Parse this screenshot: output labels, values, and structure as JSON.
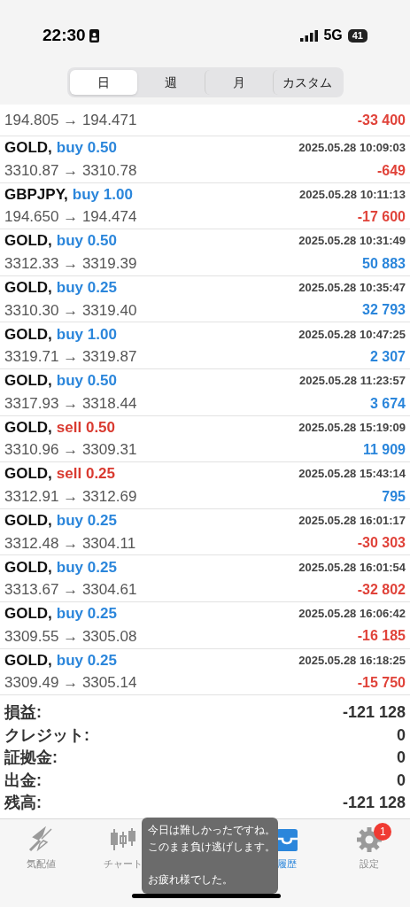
{
  "status_bar": {
    "time": "22:30",
    "network": "5G",
    "battery": "41"
  },
  "tabs": [
    {
      "label": "日",
      "selected": true
    },
    {
      "label": "週",
      "selected": false
    },
    {
      "label": "月",
      "selected": false
    },
    {
      "label": "カスタム",
      "selected": false
    }
  ],
  "partial_row": {
    "prices": "194.805 → 194.471",
    "profit": "-33 400",
    "loss": true
  },
  "trades": [
    {
      "symbol": "GOLD,",
      "kind": "buy",
      "action": "buy 0.50",
      "time": "2025.05.28 10:09:03",
      "prices": "3310.87 → 3310.78",
      "profit": "-649",
      "loss": true
    },
    {
      "symbol": "GBPJPY,",
      "kind": "buy",
      "action": "buy 1.00",
      "time": "2025.05.28 10:11:13",
      "prices": "194.650 → 194.474",
      "profit": "-17 600",
      "loss": true
    },
    {
      "symbol": "GOLD,",
      "kind": "buy",
      "action": "buy 0.50",
      "time": "2025.05.28 10:31:49",
      "prices": "3312.33 → 3319.39",
      "profit": "50 883",
      "loss": false
    },
    {
      "symbol": "GOLD,",
      "kind": "buy",
      "action": "buy 0.25",
      "time": "2025.05.28 10:35:47",
      "prices": "3310.30 → 3319.40",
      "profit": "32 793",
      "loss": false
    },
    {
      "symbol": "GOLD,",
      "kind": "buy",
      "action": "buy 1.00",
      "time": "2025.05.28 10:47:25",
      "prices": "3319.71 → 3319.87",
      "profit": "2 307",
      "loss": false
    },
    {
      "symbol": "GOLD,",
      "kind": "buy",
      "action": "buy 0.50",
      "time": "2025.05.28 11:23:57",
      "prices": "3317.93 → 3318.44",
      "profit": "3 674",
      "loss": false
    },
    {
      "symbol": "GOLD,",
      "kind": "sell",
      "action": "sell 0.50",
      "time": "2025.05.28 15:19:09",
      "prices": "3310.96 → 3309.31",
      "profit": "11 909",
      "loss": false
    },
    {
      "symbol": "GOLD,",
      "kind": "sell",
      "action": "sell 0.25",
      "time": "2025.05.28 15:43:14",
      "prices": "3312.91 → 3312.69",
      "profit": "795",
      "loss": false
    },
    {
      "symbol": "GOLD,",
      "kind": "buy",
      "action": "buy 0.25",
      "time": "2025.05.28 16:01:17",
      "prices": "3312.48 → 3304.11",
      "profit": "-30 303",
      "loss": true
    },
    {
      "symbol": "GOLD,",
      "kind": "buy",
      "action": "buy 0.25",
      "time": "2025.05.28 16:01:54",
      "prices": "3313.67 → 3304.61",
      "profit": "-32 802",
      "loss": true
    },
    {
      "symbol": "GOLD,",
      "kind": "buy",
      "action": "buy 0.25",
      "time": "2025.05.28 16:06:42",
      "prices": "3309.55 → 3305.08",
      "profit": "-16 185",
      "loss": true
    },
    {
      "symbol": "GOLD,",
      "kind": "buy",
      "action": "buy 0.25",
      "time": "2025.05.28 16:18:25",
      "prices": "3309.49 → 3305.14",
      "profit": "-15 750",
      "loss": true
    }
  ],
  "summary": [
    {
      "label": "損益:",
      "value": "-121 128"
    },
    {
      "label": "クレジット:",
      "value": "0"
    },
    {
      "label": "証拠金:",
      "value": "0"
    },
    {
      "label": "出金:",
      "value": "0"
    },
    {
      "label": "残高:",
      "value": "-121 128"
    }
  ],
  "nav": [
    {
      "kind": "quotes",
      "label": "気配値",
      "selected": false
    },
    {
      "kind": "chart",
      "label": "チャート",
      "selected": false
    },
    {
      "kind": "history",
      "label": "履歴",
      "selected": true
    },
    {
      "kind": "settings",
      "label": "設定",
      "selected": false,
      "badge": "1"
    }
  ],
  "toast": {
    "paragraphs": [
      [
        "今日は難しかったですね。",
        "このまま負け逃げします。"
      ],
      [
        "お疲れ様でした。"
      ]
    ]
  }
}
